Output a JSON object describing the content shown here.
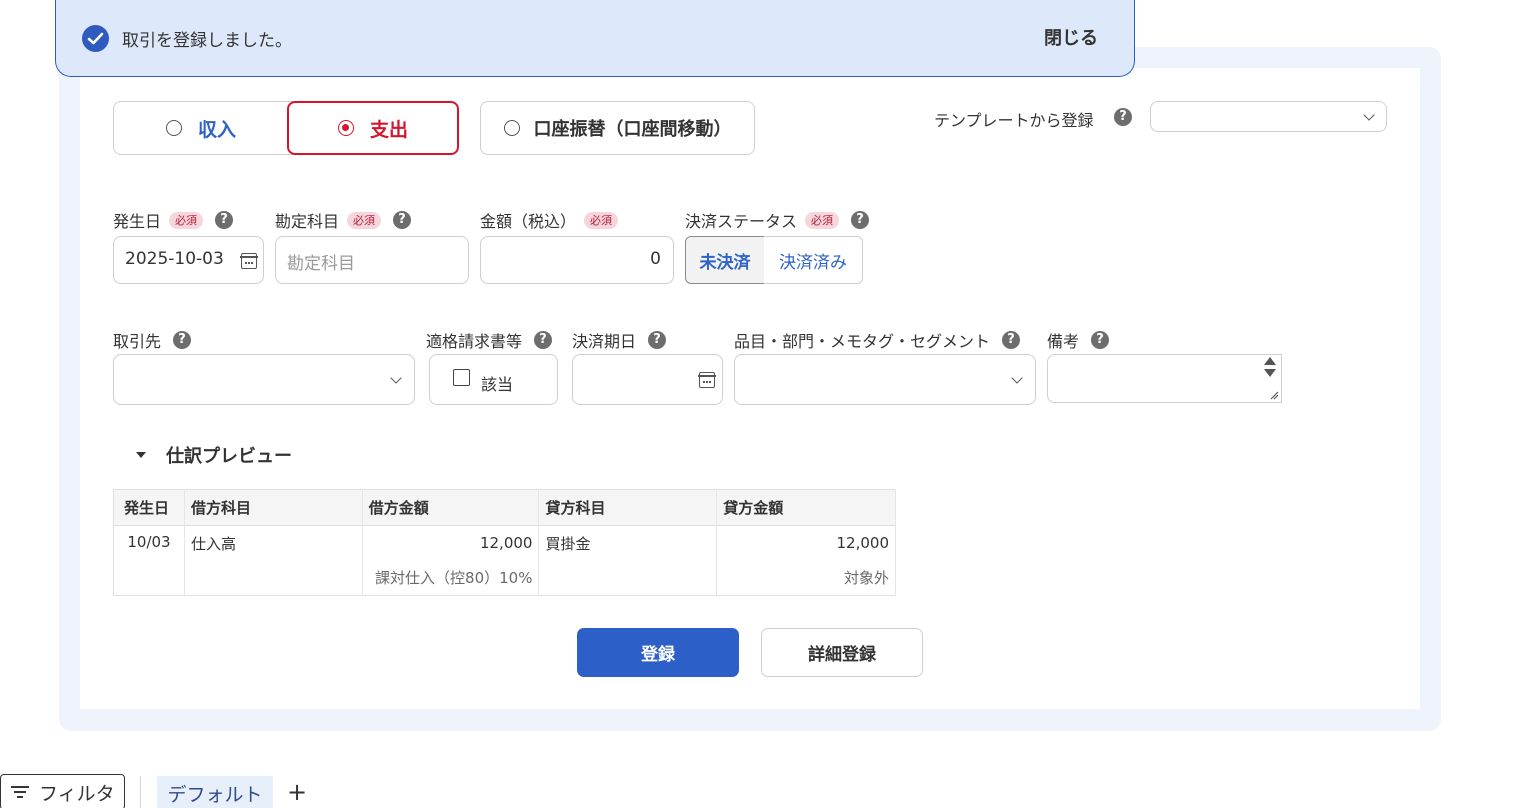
{
  "toast": {
    "message": "取引を登録しました。",
    "close_label": "閉じる",
    "icon": "check-circle-icon"
  },
  "type_selector": {
    "income_label": "収入",
    "expense_label": "支出",
    "transfer_label": "口座振替（口座間移動）",
    "selected": "支出"
  },
  "template": {
    "label": "テンプレートから登録",
    "value": ""
  },
  "fields": {
    "required_badge": "必須",
    "date": {
      "label": "発生日",
      "value": "2025-10-03"
    },
    "account": {
      "label": "勘定科目",
      "placeholder": "勘定科目"
    },
    "amount": {
      "label": "金額（税込）",
      "value": "0"
    },
    "status": {
      "label": "決済ステータス",
      "unpaid_label": "未決済",
      "paid_label": "決済済み",
      "selected": "未決済"
    },
    "partner": {
      "label": "取引先",
      "value": ""
    },
    "invoice": {
      "label": "適格請求書等",
      "checkbox_label": "該当",
      "checked": false
    },
    "due_date": {
      "label": "決済期日",
      "value": ""
    },
    "tags": {
      "label": "品目・部門・メモタグ・セグメント",
      "value": ""
    },
    "memo": {
      "label": "備考",
      "value": ""
    }
  },
  "preview": {
    "title": "仕訳プレビュー",
    "headers": [
      "発生日",
      "借方科目",
      "借方金額",
      "貸方科目",
      "貸方金額"
    ],
    "row": {
      "date": "10/03",
      "debit_account": "仕入高",
      "debit_amount": "12,000",
      "debit_tax": "課対仕入（控80）10%",
      "credit_account": "買掛金",
      "credit_amount": "12,000",
      "credit_tax": "対象外"
    }
  },
  "actions": {
    "register_label": "登録",
    "detail_register_label": "詳細登録"
  },
  "bottom_bar": {
    "filter_label": "フィルタ",
    "default_tab_label": "デフォルト",
    "add_tab_label": "+"
  },
  "colors": {
    "accent_blue": "#2c5fc7",
    "expense_red": "#d3162e",
    "toast_bg": "#dde8fb",
    "panel_bg": "#eef3fc"
  }
}
